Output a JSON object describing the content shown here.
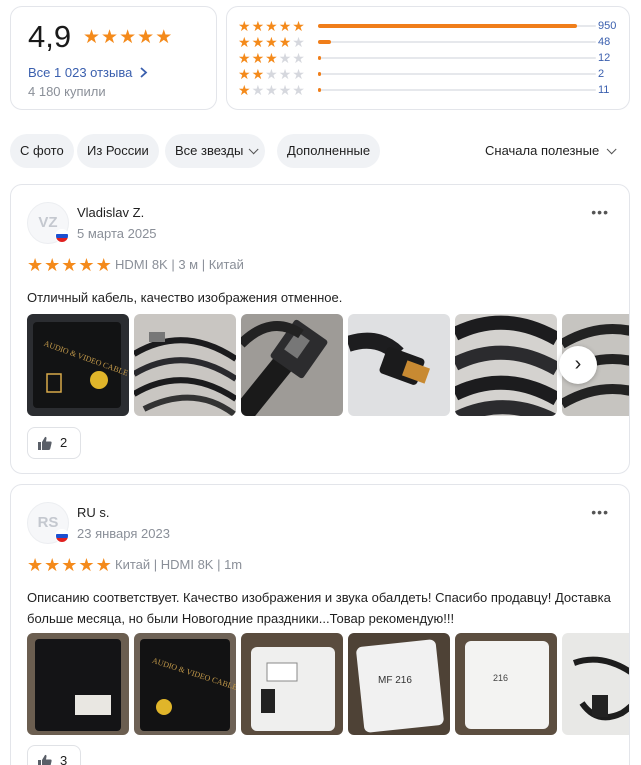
{
  "summary": {
    "rating": "4,9",
    "all_reviews": "Все 1 023 отзыва",
    "bought": "4 180 купили"
  },
  "distribution": [
    {
      "stars": 5,
      "count": "950",
      "fraction": 0.93
    },
    {
      "stars": 4,
      "count": "48",
      "fraction": 0.047
    },
    {
      "stars": 3,
      "count": "12",
      "fraction": 0.012
    },
    {
      "stars": 2,
      "count": "2",
      "fraction": 0.002
    },
    {
      "stars": 1,
      "count": "11",
      "fraction": 0.011
    }
  ],
  "filters": {
    "with_photo": "С фото",
    "from_russia": "Из России",
    "all_stars": "Все звезды",
    "supplemented": "Дополненные",
    "sort": "Сначала полезные"
  },
  "reviews": [
    {
      "initials": "VZ",
      "author": "Vladislav Z.",
      "date": "5 марта 2025",
      "rating": 5,
      "meta": "HDMI 8K | 3 м | Китай",
      "text": "Отличный кабель, качество изображения отменное.",
      "likes": "2",
      "photos": [
        "black package cable",
        "braided cable coil",
        "hdmi plug closeup",
        "gold hdmi connector",
        "braided cable closeup",
        "braided cable loop"
      ]
    },
    {
      "initials": "RS",
      "author": "RU s.",
      "date": "23 января 2023",
      "rating": 5,
      "meta": "Китай | HDMI 8K | 1m",
      "text": "Описанию соответствует. Качество изображения и звука обалдеть! Спасибо продавцу! Доставка больше месяца, но были Новогодние праздники...Товар рекомендую!!!",
      "likes": "3",
      "photos": [
        "black package",
        "black package video cable",
        "white parcel",
        "white parcel label",
        "white parcel bag",
        "cable on parcel"
      ]
    }
  ],
  "icons": {
    "star": "star-icon",
    "chevron": "chevron-right-icon",
    "more": "more-dots-icon",
    "like": "thumbs-up-icon",
    "flag": "russia-flag-icon"
  },
  "colors": {
    "accent": "#f48a1b",
    "link": "#3a5fae",
    "muted": "#8a8f98"
  }
}
